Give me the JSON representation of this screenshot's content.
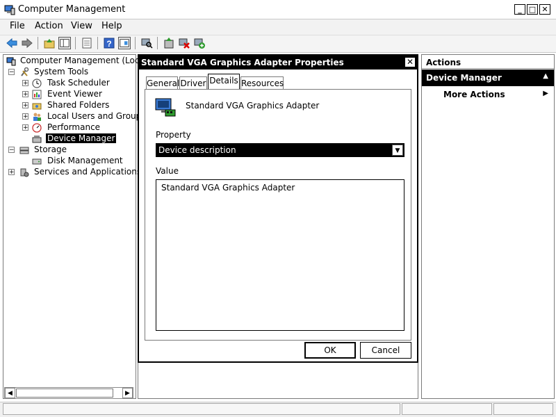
{
  "window": {
    "title": "Computer Management",
    "controls": {
      "minimize": "_",
      "maximize": "□",
      "close": "✕"
    }
  },
  "menu": [
    "File",
    "Action",
    "View",
    "Help"
  ],
  "toolbar": {
    "icons": [
      "back-icon",
      "forward-icon",
      "up-folder-icon",
      "show-hide-tree-icon",
      "properties-icon",
      "help-icon",
      "console-view-icon",
      "scan-hardware-icon",
      "update-driver-icon",
      "uninstall-icon",
      "enable-device-icon"
    ]
  },
  "tree": {
    "root": "Computer Management (Local)",
    "system_tools": "System Tools",
    "task_scheduler": "Task Scheduler",
    "event_viewer": "Event Viewer",
    "shared_folders": "Shared Folders",
    "local_users": "Local Users and Groups",
    "performance": "Performance",
    "device_manager": "Device Manager",
    "storage": "Storage",
    "disk_management": "Disk Management",
    "services": "Services and Applications"
  },
  "dialog": {
    "title": "Standard VGA Graphics Adapter Properties",
    "close": "✕",
    "tabs": [
      "General",
      "Driver",
      "Details",
      "Resources"
    ],
    "active_tab": "Details",
    "device_name": "Standard VGA Graphics Adapter",
    "property_label": "Property",
    "property_value": "Device description",
    "value_label": "Value",
    "value_text": "Standard VGA Graphics Adapter",
    "ok": "OK",
    "cancel": "Cancel"
  },
  "actions": {
    "header": "Actions",
    "selected": "Device Manager",
    "more": "More Actions"
  },
  "colors": {
    "selection": "#000000",
    "pane_border": "#7a7a7a",
    "menubar": "#f2f2f2"
  }
}
